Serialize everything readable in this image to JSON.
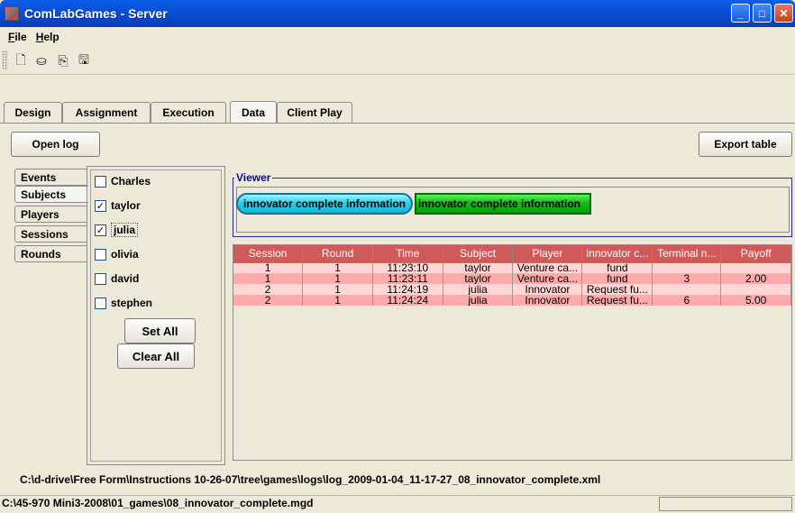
{
  "window": {
    "title": "ComLabGames - Server",
    "icon": "app-icon"
  },
  "window_controls": {
    "minimize": "minimize-icon",
    "maximize": "maximize-icon",
    "close": "close-icon"
  },
  "menu": {
    "file": {
      "mnemonic": "F",
      "rest": "ile"
    },
    "help": {
      "mnemonic": "H",
      "rest": "elp"
    }
  },
  "toolbar": [
    {
      "icon": "new-document-icon",
      "glyph": "🗋"
    },
    {
      "icon": "open-folder-icon",
      "glyph": "⛀"
    },
    {
      "icon": "copy-icon",
      "glyph": "⎘"
    },
    {
      "icon": "save-icon",
      "glyph": "🖫"
    }
  ],
  "tabs": [
    "Design",
    "Assignment",
    "Execution",
    "Data",
    "Client Play"
  ],
  "active_tab": "Data",
  "buttons": {
    "open_log": "Open log",
    "export_table": "Export table",
    "set_all": "Set All",
    "clear_all": "Clear All"
  },
  "side_tabs": [
    "Events",
    "Subjects",
    "Players",
    "Sessions",
    "Rounds"
  ],
  "active_side_tab": "Subjects",
  "subjects": [
    {
      "name": "Charles",
      "checked": false
    },
    {
      "name": "taylor",
      "checked": true
    },
    {
      "name": "julia",
      "checked": true
    },
    {
      "name": "olivia",
      "checked": false
    },
    {
      "name": "david",
      "checked": false
    },
    {
      "name": "stephen",
      "checked": false
    }
  ],
  "viewer": {
    "title": "Viewer",
    "items": [
      "innovator complete information",
      "innovator complete information"
    ]
  },
  "table": {
    "columns": [
      "Session",
      "Round",
      "Time",
      "Subject",
      "Player",
      "innovator c...",
      "Terminal n...",
      "Payoff"
    ],
    "rows": [
      [
        "1",
        "1",
        "11:23:10",
        "taylor",
        "Venture ca...",
        "fund",
        "",
        ""
      ],
      [
        "1",
        "1",
        "11:23:11",
        "taylor",
        "Venture ca...",
        "fund",
        "3",
        "2.00"
      ],
      [
        "2",
        "1",
        "11:24:19",
        "julia",
        "Innovator",
        "Request fu...",
        "",
        ""
      ],
      [
        "2",
        "1",
        "11:24:24",
        "julia",
        "Innovator",
        "Request fu...",
        "6",
        "5.00"
      ]
    ]
  },
  "log_path": "C:\\d-drive\\Free Form\\Instructions 10-26-07\\tree\\games\\logs\\log_2009-01-04_11-17-27_08_innovator_complete.xml",
  "status": {
    "game_file": "C:\\45-970 Mini3-2008\\01_games\\08_innovator_complete.mgd"
  },
  "colors": {
    "header": "#cf5a5a",
    "row_light": "#ffd6d6",
    "row_dark": "#ffaaaa",
    "pill_cyan": "#27d0ea",
    "pill_green": "#10c010"
  }
}
